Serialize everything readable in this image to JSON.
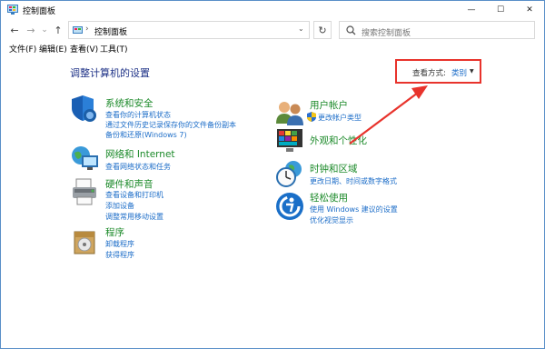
{
  "window": {
    "title": "控制面板",
    "controls": {
      "minimize": "—",
      "maximize": "☐",
      "close": "✕"
    }
  },
  "nav": {
    "back": "←",
    "forward": "→",
    "recent": "⌄",
    "up": "↑",
    "breadcrumb_sep": "›",
    "breadcrumb": "控制面板",
    "refresh": "↻",
    "search_placeholder": "搜索控制面板"
  },
  "menu": [
    "文件(F)",
    "编辑(E)",
    "查看(V)",
    "工具(T)"
  ],
  "heading": "调整计算机的设置",
  "view": {
    "label": "查看方式:",
    "value": "类别",
    "dropdown": "▼"
  },
  "categories": [
    {
      "title": "系统和安全",
      "links": [
        "查看你的计算机状态",
        "通过文件历史记录保存你的文件备份副本",
        "备份和还原(Windows 7)"
      ]
    },
    {
      "title": "网络和 Internet",
      "links": [
        "查看网络状态和任务"
      ]
    },
    {
      "title": "硬件和声音",
      "links": [
        "查看设备和打印机",
        "添加设备",
        "调整常用移动设置"
      ]
    },
    {
      "title": "程序",
      "links": [
        "卸载程序",
        "获得程序"
      ]
    },
    {
      "title": "用户帐户",
      "links": [
        "更改帐户类型"
      ]
    },
    {
      "title": "外观和个性化",
      "links": []
    },
    {
      "title": "时钟和区域",
      "links": [
        "更改日期、时间或数字格式"
      ]
    },
    {
      "title": "轻松使用",
      "links": [
        "使用 Windows 建议的设置",
        "优化视觉显示"
      ]
    }
  ],
  "colors": {
    "accent_blue": "#1c6dc8",
    "category_green": "#1c8a2a",
    "heading_blue": "#1e3287",
    "annotation_red": "#e8332c"
  }
}
